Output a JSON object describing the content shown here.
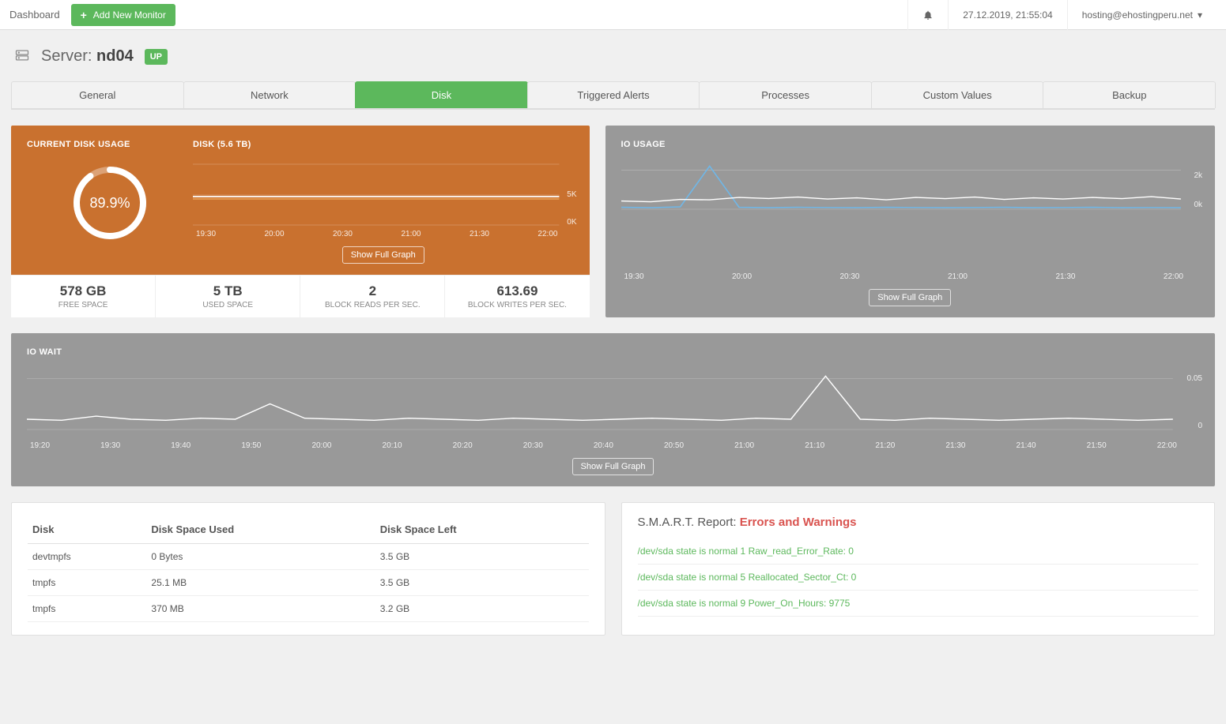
{
  "topbar": {
    "dashboard": "Dashboard",
    "add_monitor": "Add New Monitor",
    "datetime": "27.12.2019, 21:55:04",
    "user": "hosting@ehostingperu.net"
  },
  "header": {
    "prefix": "Server:",
    "name": "nd04",
    "status": "UP"
  },
  "tabs": [
    "General",
    "Network",
    "Disk",
    "Triggered Alerts",
    "Processes",
    "Custom Values",
    "Backup"
  ],
  "active_tab": "Disk",
  "disk_usage": {
    "title": "CURRENT DISK USAGE",
    "percent": "89.9%",
    "percent_value": 89.9,
    "chart_title": "DISK (5.6 TB)",
    "show_full": "Show Full Graph"
  },
  "stats": [
    {
      "value": "578 GB",
      "label": "FREE SPACE"
    },
    {
      "value": "5 TB",
      "label": "USED SPACE"
    },
    {
      "value": "2",
      "label": "BLOCK READS PER SEC."
    },
    {
      "value": "613.69",
      "label": "BLOCK WRITES PER SEC."
    }
  ],
  "io_usage": {
    "title": "IO USAGE",
    "show_full": "Show Full Graph"
  },
  "io_wait": {
    "title": "IO WAIT",
    "show_full": "Show Full Graph"
  },
  "disk_table": {
    "headers": [
      "Disk",
      "Disk Space Used",
      "Disk Space Left"
    ],
    "rows": [
      [
        "devtmpfs",
        "0 Bytes",
        "3.5 GB"
      ],
      [
        "tmpfs",
        "25.1 MB",
        "3.5 GB"
      ],
      [
        "tmpfs",
        "370 MB",
        "3.2 GB"
      ]
    ]
  },
  "smart": {
    "title_prefix": "S.M.A.R.T. Report:",
    "title_alert": "Errors and Warnings",
    "rows": [
      "/dev/sda state is normal 1 Raw_read_Error_Rate: 0",
      "/dev/sda state is normal 5 Reallocated_Sector_Ct: 0",
      "/dev/sda state is normal 9 Power_On_Hours: 9775"
    ]
  },
  "chart_data": [
    {
      "type": "line",
      "title": "DISK (5.6 TB)",
      "x_ticks": [
        "19:30",
        "20:00",
        "20:30",
        "21:00",
        "21:30",
        "22:00"
      ],
      "ylim": [
        0,
        6000
      ],
      "y_ticks": [
        "0K",
        "5K"
      ],
      "series": [
        {
          "name": "disk",
          "values": [
            5000,
            5000,
            5000,
            5000,
            5000,
            5000,
            5000,
            5000,
            5000,
            5000,
            5000,
            5000
          ]
        }
      ]
    },
    {
      "type": "line",
      "title": "IO USAGE",
      "x_ticks": [
        "19:30",
        "20:00",
        "20:30",
        "21:00",
        "21:30",
        "22:00"
      ],
      "ylim": [
        0,
        2500
      ],
      "y_ticks": [
        "0k",
        "2k"
      ],
      "series": [
        {
          "name": "reads",
          "color": "#6fb7e8",
          "values": [
            100,
            80,
            120,
            2200,
            100,
            80,
            100,
            90,
            80,
            100,
            90,
            80,
            90,
            100,
            80,
            90,
            100,
            80,
            90,
            80
          ]
        },
        {
          "name": "writes",
          "color": "#ffffff",
          "values": [
            420,
            380,
            500,
            480,
            600,
            550,
            620,
            520,
            580,
            480,
            600,
            540,
            620,
            500,
            580,
            520,
            600,
            540,
            640,
            520
          ]
        }
      ]
    },
    {
      "type": "line",
      "title": "IO WAIT",
      "x_ticks": [
        "19:20",
        "19:30",
        "19:40",
        "19:50",
        "20:00",
        "20:10",
        "20:20",
        "20:30",
        "20:40",
        "20:50",
        "21:00",
        "21:10",
        "21:20",
        "21:30",
        "21:40",
        "21:50",
        "22:00"
      ],
      "ylim": [
        0,
        0.06
      ],
      "y_ticks": [
        "0",
        "0.05"
      ],
      "series": [
        {
          "name": "wait",
          "color": "#ffffff",
          "values": [
            0.01,
            0.009,
            0.013,
            0.01,
            0.009,
            0.011,
            0.01,
            0.025,
            0.011,
            0.01,
            0.009,
            0.011,
            0.01,
            0.009,
            0.011,
            0.01,
            0.009,
            0.01,
            0.011,
            0.01,
            0.009,
            0.011,
            0.01,
            0.052,
            0.01,
            0.009,
            0.011,
            0.01,
            0.009,
            0.01,
            0.011,
            0.01,
            0.009,
            0.01
          ]
        }
      ]
    }
  ]
}
